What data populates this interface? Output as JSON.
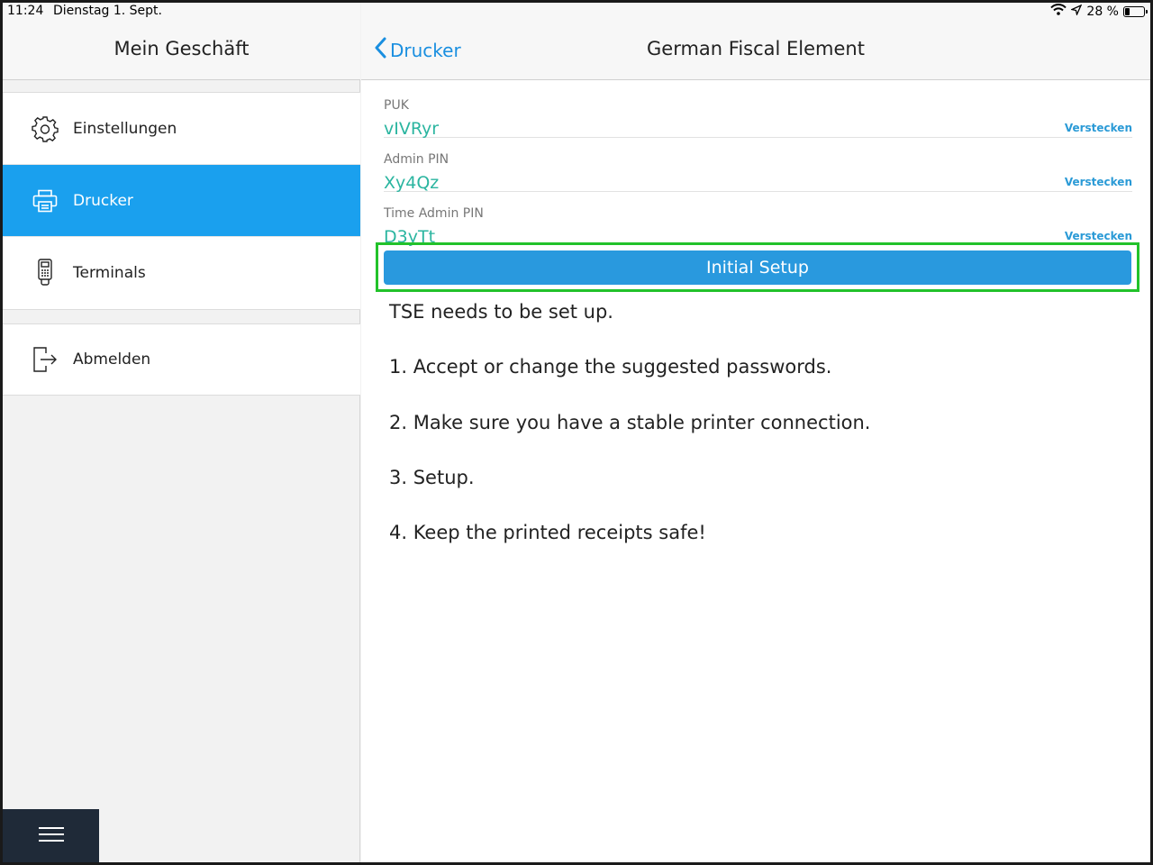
{
  "status_bar": {
    "time": "11:24",
    "date": "Dienstag 1. Sept.",
    "battery": "28 %",
    "battery_level": 0.28
  },
  "sidebar": {
    "title": "Mein Geschäft",
    "items": [
      {
        "label": "Einstellungen",
        "icon": "gear-icon",
        "active": false
      },
      {
        "label": "Drucker",
        "icon": "printer-icon",
        "active": true
      },
      {
        "label": "Terminals",
        "icon": "card-terminal-icon",
        "active": false
      }
    ],
    "logout": {
      "label": "Abmelden",
      "icon": "logout-icon"
    },
    "menu_icon": "hamburger-icon"
  },
  "main": {
    "back_label": "Drucker",
    "title": "German Fiscal Element",
    "fields": [
      {
        "label": "PUK",
        "value": "vIVRyr",
        "action": "Verstecken"
      },
      {
        "label": "Admin PIN",
        "value": "Xy4Qz",
        "action": "Verstecken"
      },
      {
        "label": "Time Admin PIN",
        "value": "D3yTt",
        "action": "Verstecken"
      }
    ],
    "setup_button": "Initial Setup",
    "instructions": [
      "TSE needs to be set up.",
      "1. Accept or change the suggested passwords.",
      "2. Make sure you have a stable printer connection.",
      "3. Setup.",
      "4. Keep the printed receipts safe!"
    ]
  },
  "colors": {
    "accent": "#1aa0ee",
    "value_text": "#2bb5a0",
    "button": "#2999de",
    "highlight": "#22c22a"
  }
}
